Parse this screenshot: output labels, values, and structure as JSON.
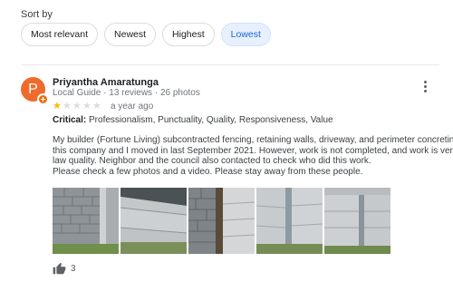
{
  "sort": {
    "label": "Sort by",
    "options": [
      "Most relevant",
      "Newest",
      "Highest",
      "Lowest"
    ],
    "selected": "Lowest"
  },
  "review": {
    "avatar_letter": "P",
    "name": "Priyantha Amaratunga",
    "meta": "Local Guide · 13 reviews · 26 photos",
    "rating": 1,
    "rating_max": 5,
    "time": "a year ago",
    "critical_label": "Critical:",
    "critical_items": "Professionalism, Punctuality, Quality, Responsiveness, Value",
    "body_lines": [
      "My builder (Fortune Living) subcontracted fencing, retaining walls, driveway, and perimeter concreting to",
      "this company and I moved in last September 2021. However, work is not completed, and work is very",
      "law quality. Neighbor and the council also contacted to check who did this work.",
      "Please check a few photos and a video.  Please stay away from these people."
    ],
    "photo_count": 5,
    "likes": "3"
  },
  "colors": {
    "accent": "#1967d2",
    "chip_active_bg": "#e8f0fe",
    "avatar": "#f06a2b",
    "star": "#fbbc04"
  },
  "icons": {
    "more": "more-vert-icon",
    "like": "thumb-up-icon",
    "badge": "local-guide-badge-icon"
  }
}
